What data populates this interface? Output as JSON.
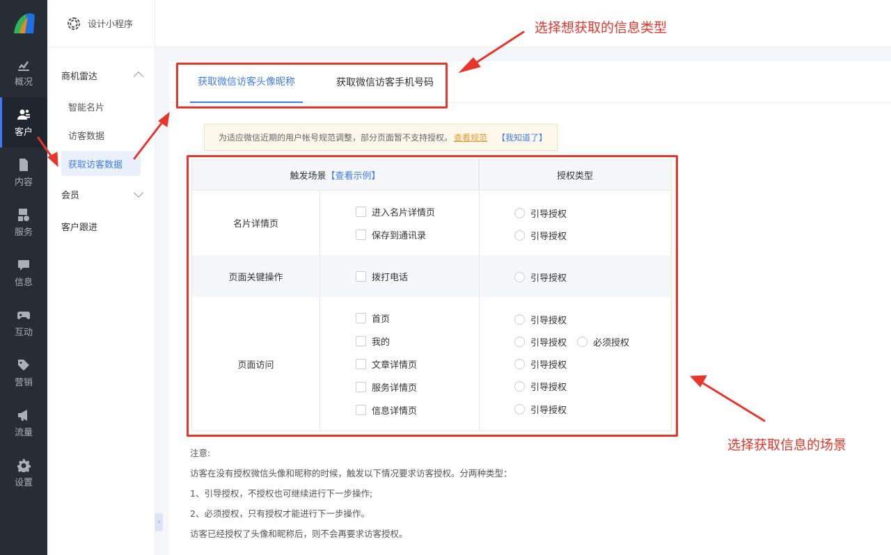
{
  "rail": {
    "items": [
      {
        "label": "概况",
        "icon": "chart-icon"
      },
      {
        "label": "客户",
        "icon": "users-icon"
      },
      {
        "label": "内容",
        "icon": "document-icon"
      },
      {
        "label": "服务",
        "icon": "service-icon"
      },
      {
        "label": "信息",
        "icon": "message-icon"
      },
      {
        "label": "互动",
        "icon": "gamepad-icon"
      },
      {
        "label": "营销",
        "icon": "tag-icon"
      },
      {
        "label": "流量",
        "icon": "megaphone-icon"
      },
      {
        "label": "设置",
        "icon": "gear-icon"
      }
    ],
    "active_index": 1
  },
  "submenu": {
    "header": "设计小程序",
    "group1": "商机雷达",
    "items": [
      "智能名片",
      "访客数据",
      "获取访客数据"
    ],
    "group2": "会员",
    "group3": "客户跟进"
  },
  "tabs": {
    "tab1": "获取微信访客头像昵称",
    "tab2": "获取微信访客手机号码"
  },
  "notice": {
    "text": "为适应微信近期的用户帐号规范调整，部分页面暂不支持授权。",
    "link": "查看规范",
    "ok": "【我知道了】"
  },
  "table": {
    "header_scene": "触发场景",
    "header_example": "【查看示例】",
    "header_type": "授权类型",
    "rows": [
      {
        "scene": "名片详情页",
        "options": [
          "进入名片详情页",
          "保存到通讯录"
        ]
      },
      {
        "scene": "页面关键操作",
        "options": [
          "拨打电话"
        ]
      },
      {
        "scene": "页面访问",
        "options": [
          "首页",
          "我的",
          "文章详情页",
          "服务详情页",
          "信息详情页"
        ]
      }
    ],
    "guide": "引导授权",
    "must": "必须授权"
  },
  "notes": [
    "注意:",
    "访客在没有授权微信头像和昵称的时候，触发以下情况要求访客授权。分两种类型：",
    "1、引导授权，不授权也可继续进行下一步操作;",
    "2、必须授权，只有授权才能进行下一步操作。",
    "访客已经授权了头像和昵称后，则不会再要求访客授权。"
  ],
  "annotations": {
    "top": "选择想获取的信息类型",
    "bottom": "选择获取信息的场景",
    "color": "#e8352b"
  },
  "colors": {
    "accent": "#3f7bf5",
    "rail_bg": "#262d36"
  }
}
